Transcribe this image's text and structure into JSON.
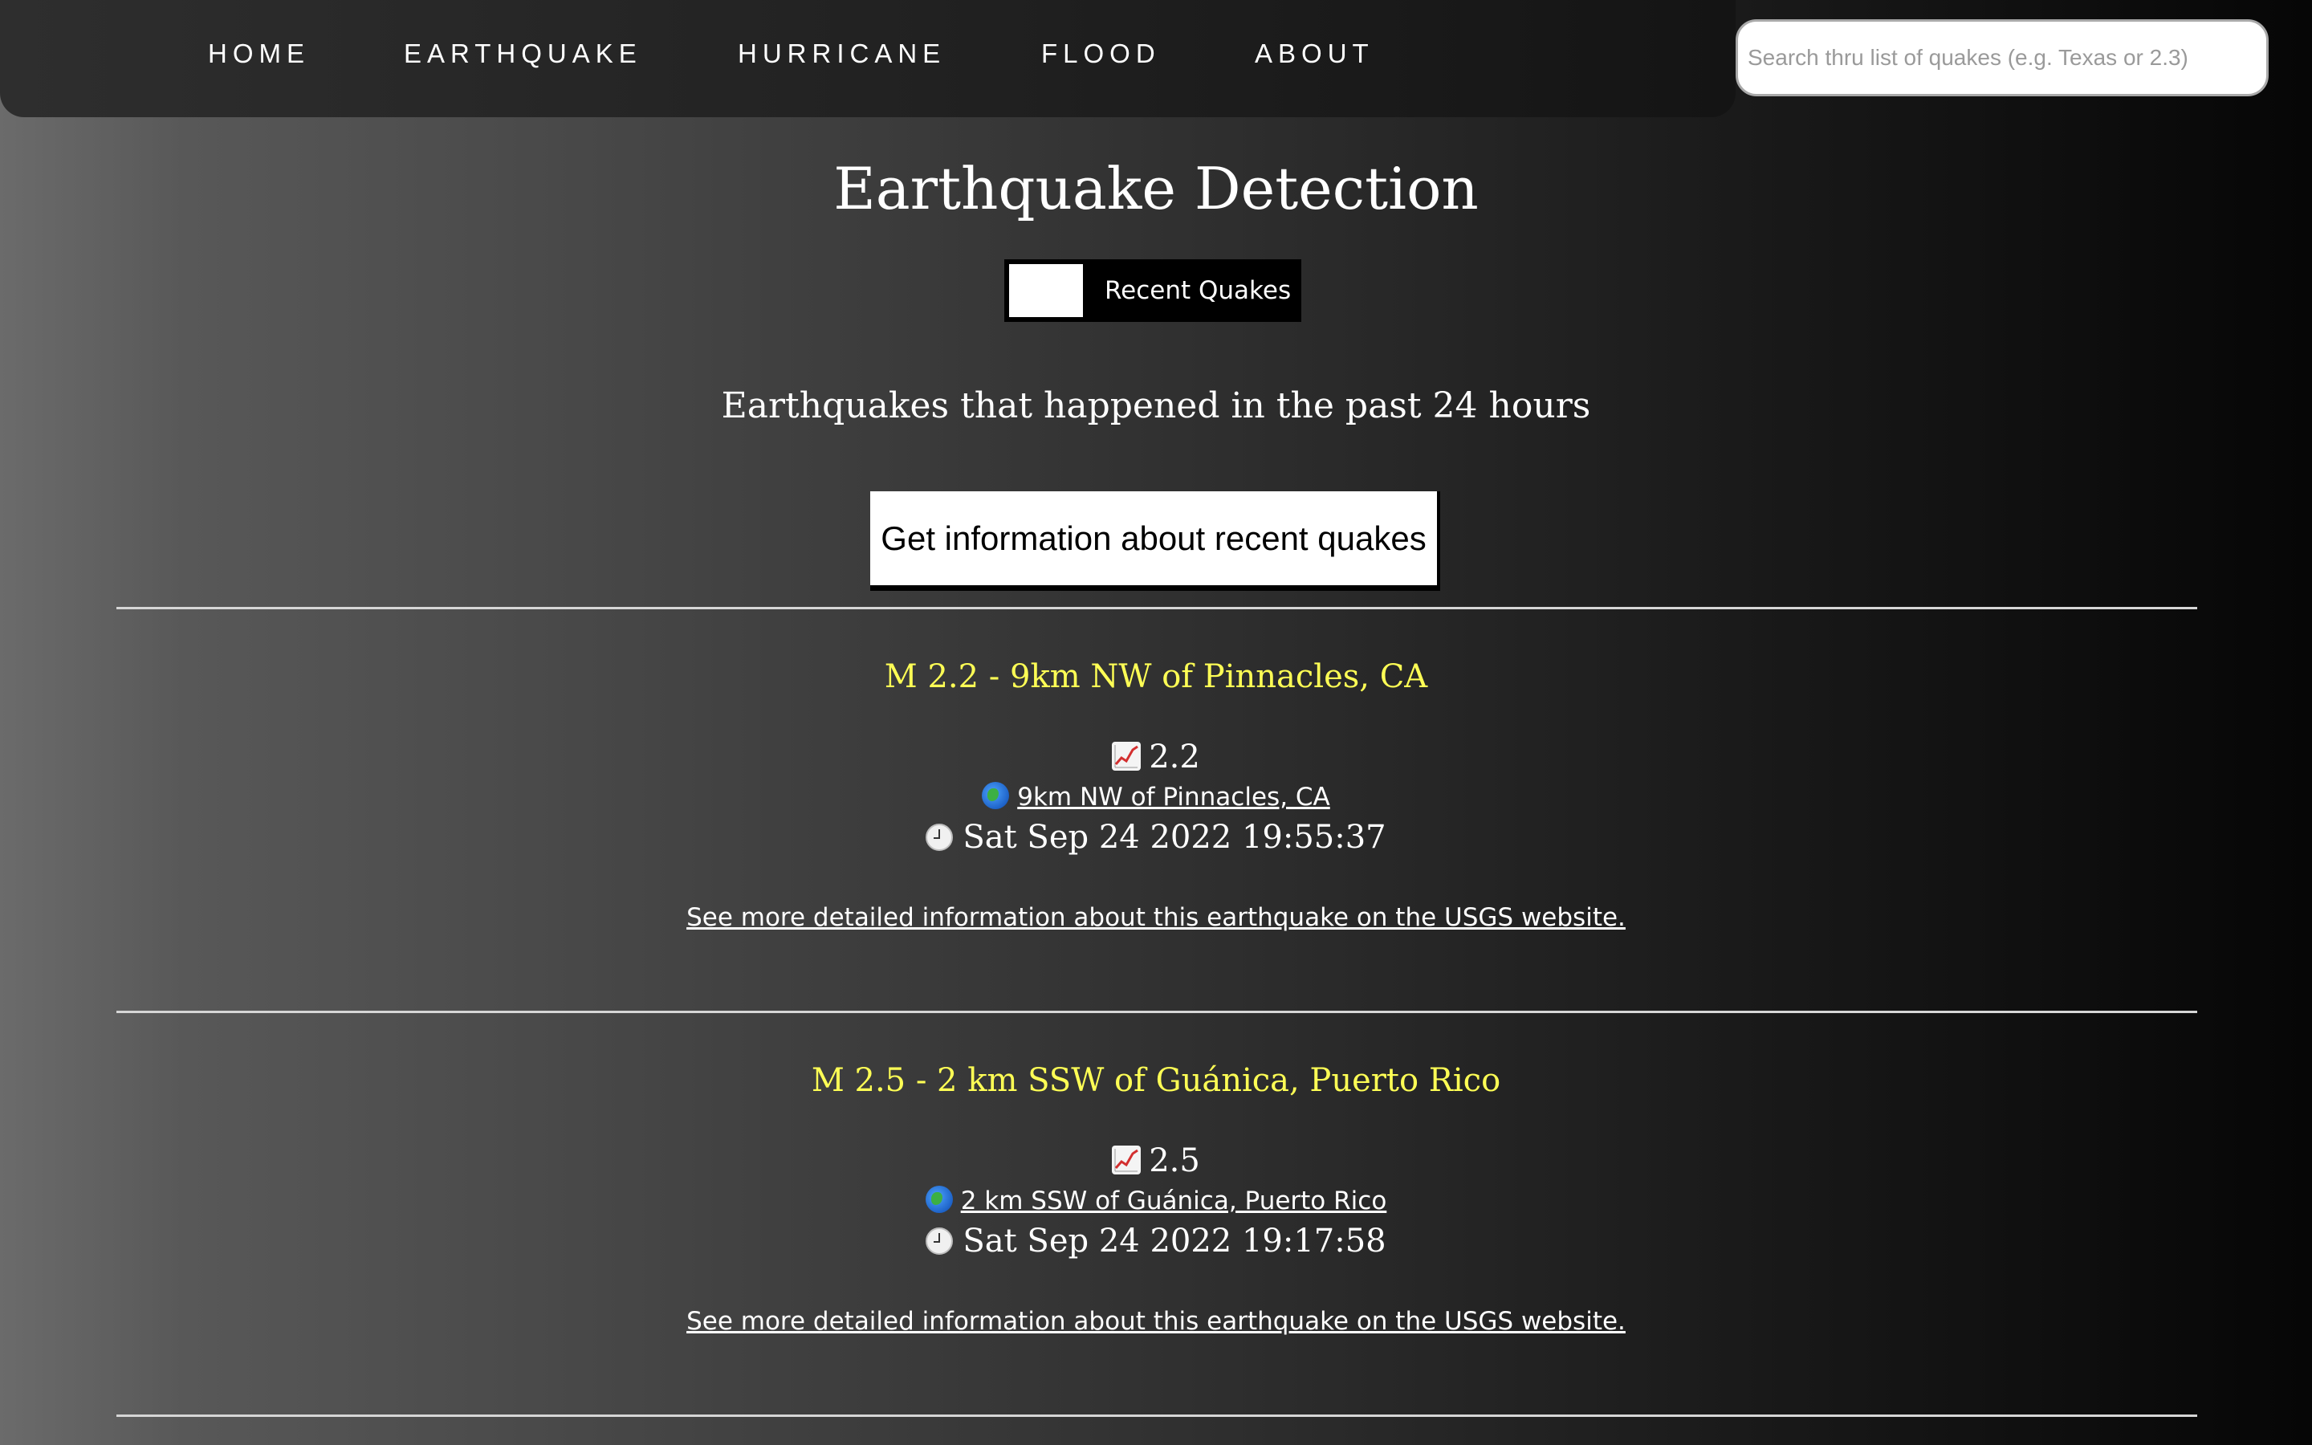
{
  "nav": {
    "items": [
      {
        "label": "HOME"
      },
      {
        "label": "EARTHQUAKE"
      },
      {
        "label": "HURRICANE"
      },
      {
        "label": "FLOOD"
      },
      {
        "label": "ABOUT"
      }
    ]
  },
  "search": {
    "placeholder": "Search thru list of quakes (e.g. Texas or 2.3)",
    "value": ""
  },
  "main": {
    "title": "Earthquake Detection",
    "toggle_label": "Recent Quakes",
    "subtitle": "Earthquakes that happened in the past 24 hours",
    "info_button_label": "Get information about recent quakes"
  },
  "quakes": [
    {
      "title": "M 2.2 - 9km NW of Pinnacles, CA",
      "magnitude": "2.2",
      "location": "9km NW of Pinnacles, CA",
      "time": "Sat Sep 24 2022 19:55:37",
      "usgs_link": "See more detailed information about this earthquake on the USGS website."
    },
    {
      "title": "M 2.5 - 2 km SSW of Guánica, Puerto Rico",
      "magnitude": "2.5",
      "location": "2 km SSW of Guánica, Puerto Rico",
      "time": "Sat Sep 24 2022 19:17:58",
      "usgs_link": "See more detailed information about this earthquake on the USGS website."
    }
  ],
  "icons": {
    "magnitude": "chart-increasing-icon",
    "location": "globe-icon",
    "time": "clock-icon"
  },
  "colors": {
    "quake_title": "#ffff55",
    "button_bg": "#ffffff",
    "toggle_bg": "#000000"
  }
}
